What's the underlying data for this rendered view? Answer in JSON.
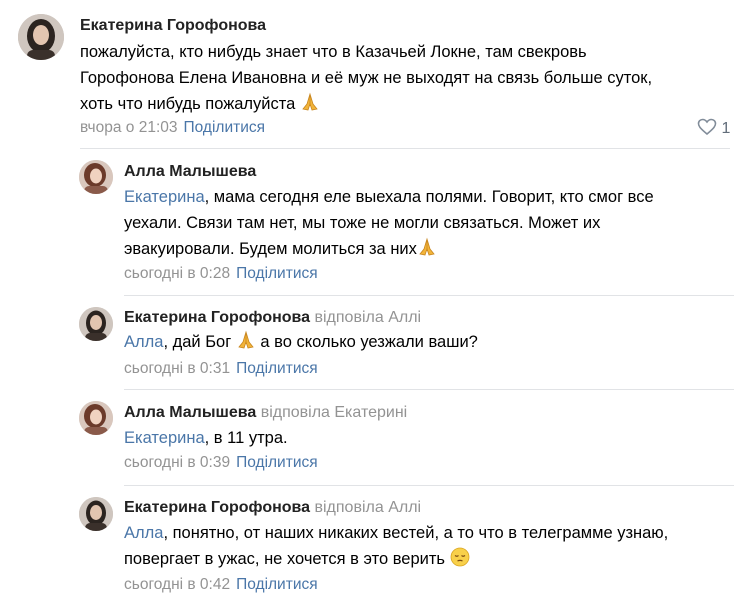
{
  "comments": [
    {
      "author": "Екатерина Горофонова",
      "reply_to": "",
      "mention": "",
      "text_lines": [
        "пожалуйста, кто нибудь знает что в Казачьей Локне, там свекровь",
        "Горофонова Елена Ивановна и её муж не выходят на связь больше суток,",
        "хоть что нибудь пожалуйста"
      ],
      "emoji": "pray-emoji",
      "time": "вчора о 21:03",
      "share_label": "Поділитися",
      "like_count": "1"
    },
    {
      "author": "Алла Малышева",
      "reply_to": "",
      "mention": "Екатерина",
      "text_lines": [
        ", мама сегодня еле выехала полями. Говорит, кто смог все",
        "уехали. Связи там нет, мы тоже не могли связаться. Может их",
        "эвакуировали. Будем молиться за них"
      ],
      "emoji": "pray-emoji",
      "time": "сьогодні в 0:28",
      "share_label": "Поділитися"
    },
    {
      "author": "Екатерина Горофонова",
      "reply_to": "відповіла Аллі",
      "mention": "Алла",
      "text_lines": [
        ", дай Бог",
        " а во сколько уезжали ваши?"
      ],
      "emoji": "pray-emoji",
      "time": "сьогодні в 0:31",
      "share_label": "Поділитися"
    },
    {
      "author": "Алла Малышева",
      "reply_to": "відповіла Екатерині",
      "mention": "Екатерина",
      "text_lines": [
        ", в 11 утра."
      ],
      "time": "сьогодні в 0:39",
      "share_label": "Поділитися"
    },
    {
      "author": "Екатерина Горофонова",
      "reply_to": "відповіла Аллі",
      "mention": "Алла",
      "text_lines": [
        ", понятно, от наших никаких вестей, а то что в телеграмме узнаю,",
        "повергает в ужас, не хочется в это верить"
      ],
      "emoji": "pensive-emoji",
      "time": "сьогодні в 0:42",
      "share_label": "Поділитися"
    }
  ],
  "colors": {
    "link": "#4a76a8",
    "secondary_text": "#939393",
    "divider": "#e1e3e6"
  }
}
